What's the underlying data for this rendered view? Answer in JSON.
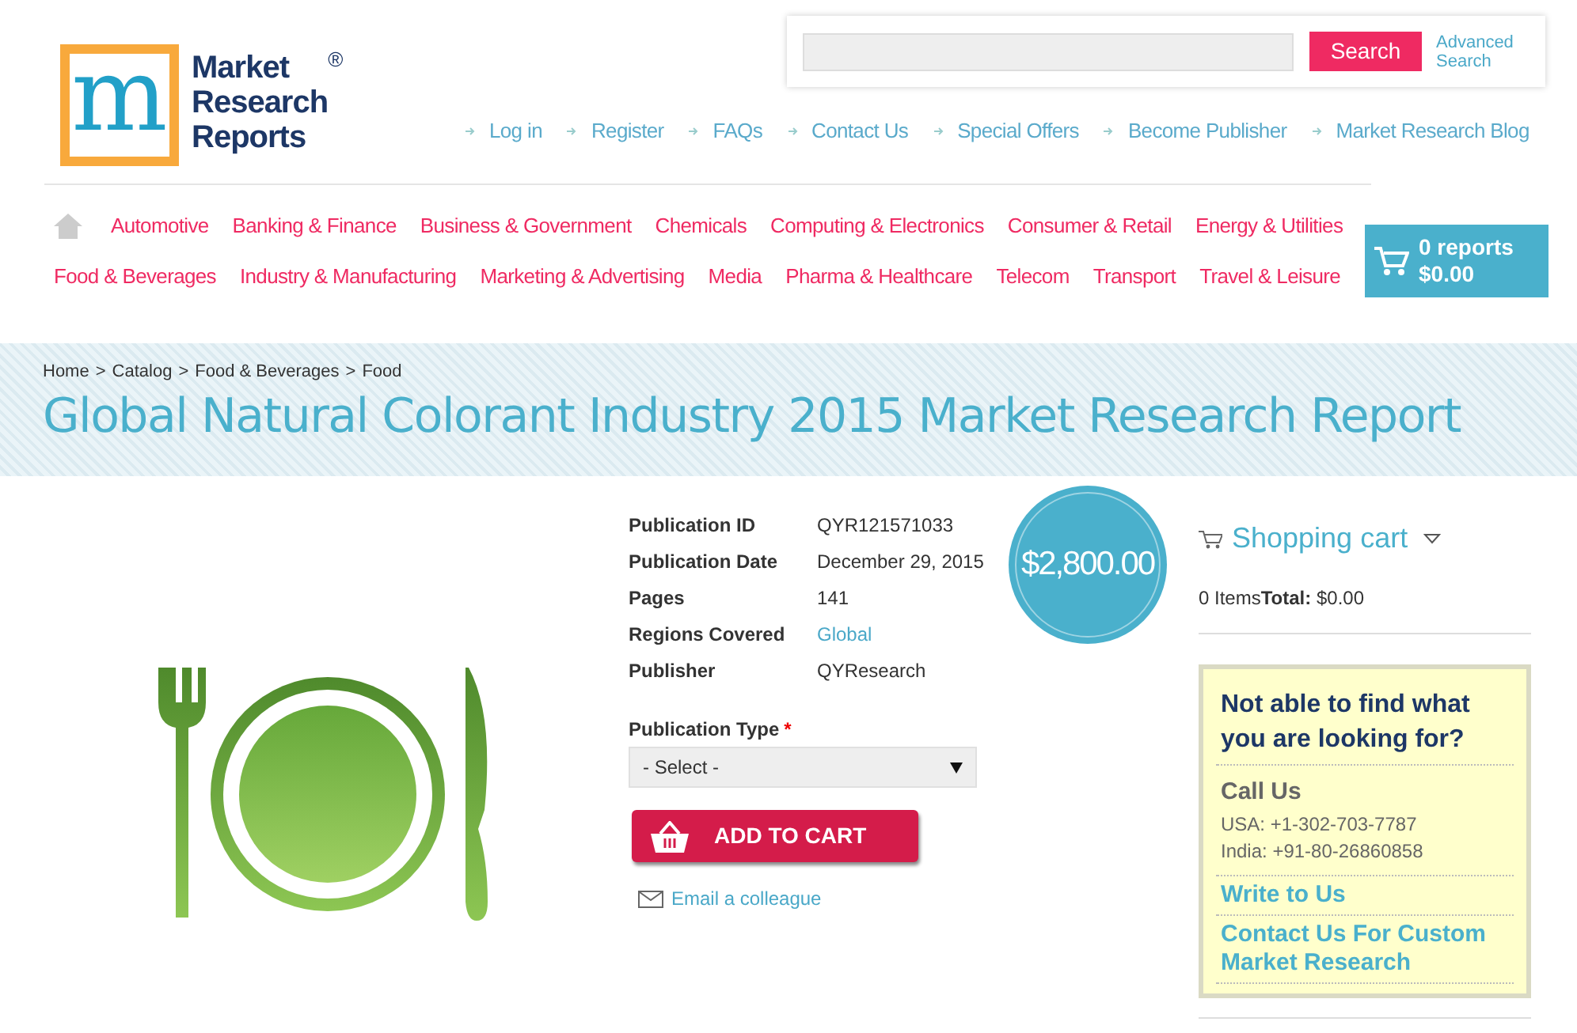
{
  "logo": {
    "mark": "m",
    "lines": [
      "Market",
      "Research",
      "Reports"
    ],
    "registered": "®"
  },
  "search": {
    "button": "Search",
    "advanced": [
      "Advanced",
      "Search"
    ]
  },
  "top_links": [
    "Log in",
    "Register",
    "FAQs",
    "Contact Us",
    "Special Offers",
    "Become Publisher",
    "Market Research Blog"
  ],
  "nav_rows": [
    [
      "Automotive",
      "Banking & Finance",
      "Business & Government",
      "Chemicals",
      "Computing & Electronics",
      "Consumer & Retail",
      "Energy & Utilities"
    ],
    [
      "Food & Beverages",
      "Industry & Manufacturing",
      "Marketing & Advertising",
      "Media",
      "Pharma & Healthcare",
      "Telecom",
      "Transport",
      "Travel & Leisure"
    ]
  ],
  "cart_button": {
    "count": "0 reports",
    "total": "$0.00"
  },
  "breadcrumbs": {
    "items": [
      "Home",
      "Catalog",
      "Food & Beverages",
      "Food"
    ],
    "separator": ">"
  },
  "title": "Global Natural Colorant Industry 2015 Market Research Report",
  "details": [
    {
      "label": "Publication ID",
      "value": "QYR121571033",
      "kind": "text"
    },
    {
      "label": "Publication Date",
      "value": "December 29, 2015",
      "kind": "text"
    },
    {
      "label": "Pages",
      "value": "141",
      "kind": "text"
    },
    {
      "label": "Regions Covered",
      "value": "Global",
      "kind": "link"
    },
    {
      "label": "Publisher",
      "value": "QYResearch",
      "kind": "text"
    }
  ],
  "price": "$2,800.00",
  "publication_type": {
    "label": "Publication Type",
    "required": "*",
    "value": "- Select -"
  },
  "add_to_cart": "ADD TO CART",
  "email_link": "Email a colleague",
  "shopping_cart": {
    "title": "Shopping cart",
    "summary": "0 Items**Total:** $0.00"
  },
  "help_box": {
    "heading": "Not able to find what you are looking for?",
    "call_title": "Call Us",
    "phones": [
      "USA: +1-302-703-7787",
      "India: +91-80-26860858"
    ],
    "links": [
      "Write to Us",
      "Contact Us For Custom Market Research"
    ]
  }
}
